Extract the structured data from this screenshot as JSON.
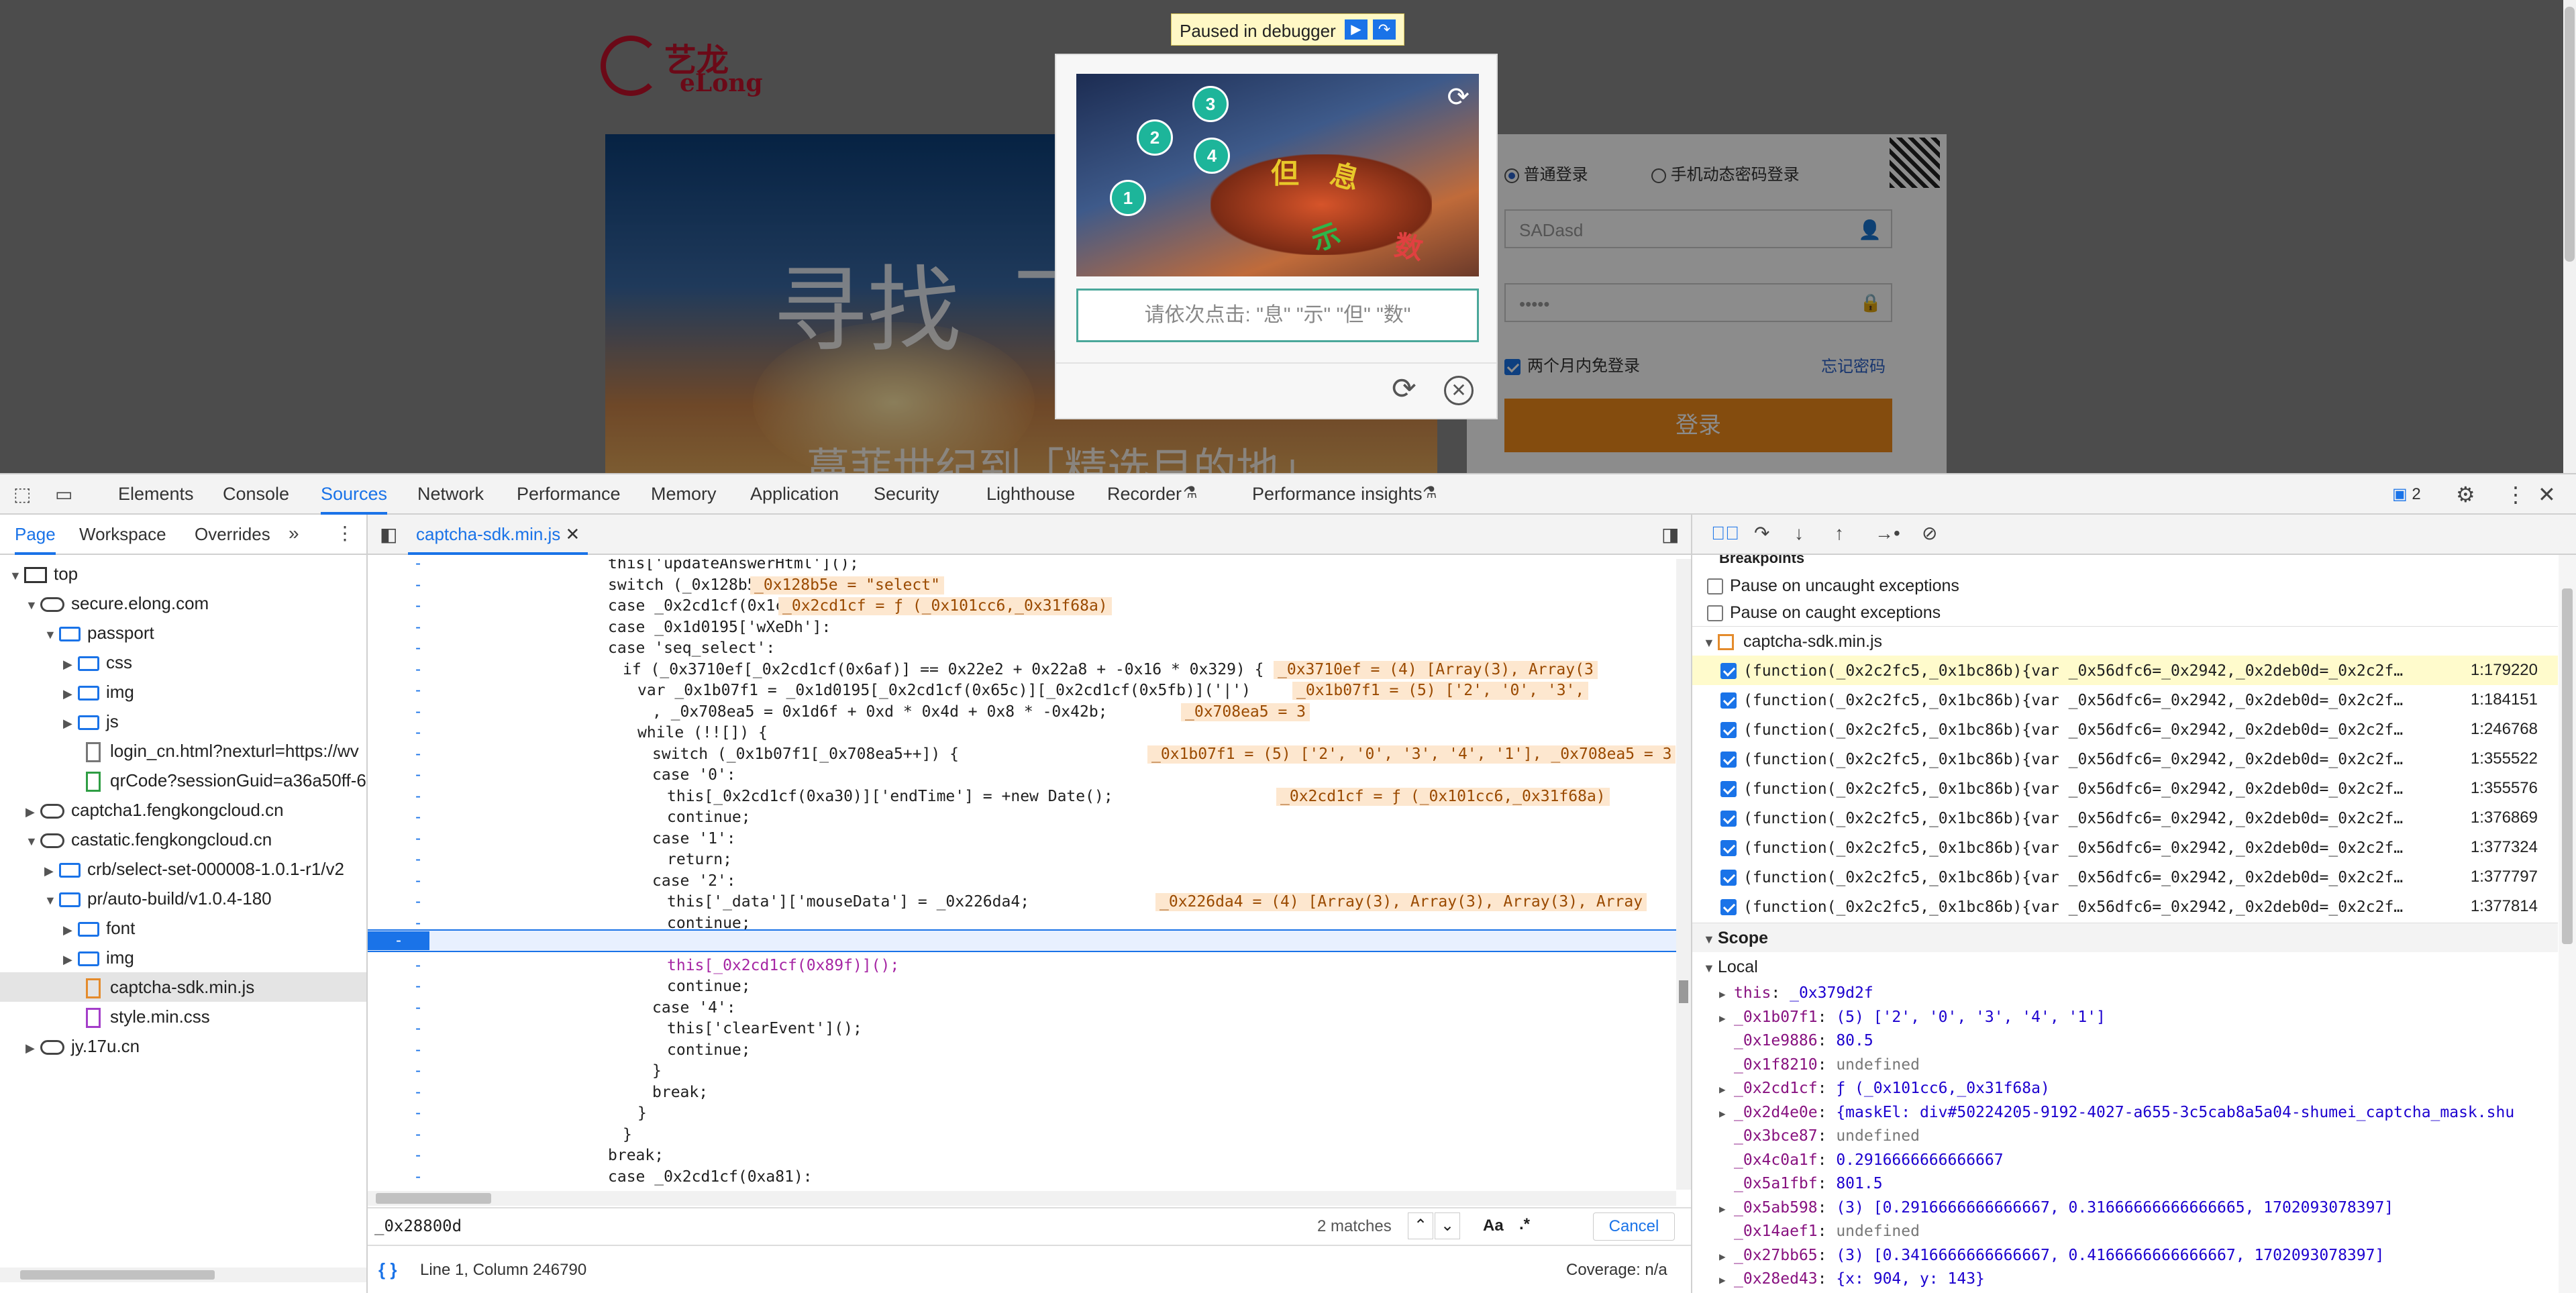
{
  "page": {
    "logo_cn": "艺龙",
    "logo_en": "eLong",
    "hero_text": "寻找  下",
    "hero_sub": "蔓菲世纪到「精选目的地」",
    "login": {
      "radio_normal": "普通登录",
      "radio_mobile": "手机动态密码登录",
      "username": "SADasd",
      "password": "•••••",
      "remember": "两个月内免登录",
      "forgot": "忘记密码",
      "submit": "登录"
    }
  },
  "debugger_badge": {
    "label": "Paused in debugger"
  },
  "captcha": {
    "dots": [
      "1",
      "2",
      "3",
      "4"
    ],
    "chars": [
      "息",
      "示",
      "但",
      "数"
    ],
    "prompt": "请依次点击: \"息\" \"示\" \"但\" \"数\""
  },
  "devtools": {
    "tabs": [
      "Elements",
      "Console",
      "Sources",
      "Network",
      "Performance",
      "Memory",
      "Application",
      "Security",
      "Lighthouse",
      "Recorder",
      "Performance insights"
    ],
    "active_tab": "Sources",
    "issues_count": "2",
    "nav": {
      "tabs": [
        "Page",
        "Workspace",
        "Overrides"
      ],
      "tree": [
        {
          "label": "top"
        },
        {
          "label": "secure.elong.com"
        },
        {
          "label": "passport"
        },
        {
          "label": "css"
        },
        {
          "label": "img"
        },
        {
          "label": "js"
        },
        {
          "label": "login_cn.html?nexturl=https://wv"
        },
        {
          "label": "qrCode?sessionGuid=a36a50ff-6"
        },
        {
          "label": "captcha1.fengkongcloud.cn"
        },
        {
          "label": "castatic.fengkongcloud.cn"
        },
        {
          "label": "crb/select-set-000008-1.0.1-r1/v2"
        },
        {
          "label": "pr/auto-build/v1.0.4-180"
        },
        {
          "label": "font"
        },
        {
          "label": "img"
        },
        {
          "label": "captcha-sdk.min.js"
        },
        {
          "label": "style.min.css"
        },
        {
          "label": "jy.17u.cn"
        }
      ]
    },
    "editor": {
      "file_tab": "captcha-sdk.min.js",
      "lines": [
        "this['updateAnswerHtml']();",
        "switch (_0x128b5e) {",
        "case _0x2cd1cf(0x1ca):",
        "case _0x1d0195['wXeDh']:",
        "case 'seq_select':",
        "if (_0x3710ef[_0x2cd1cf(0x6af)] == 0x22e2 + 0x22a8 + -0x16 * 0x329) {",
        "var _0x1b07f1 = _0x1d0195[_0x2cd1cf(0x65c)][_0x2cd1cf(0x5fb)]('|')",
        ", _0x708ea5 = 0x1d6f + 0xd * 0x4d + 0x8 * -0x42b;",
        "while (!![]) {",
        "switch (_0x1b07f1[_0x708ea5++]) {",
        "case '0':",
        "this[_0x2cd1cf(0xa30)]['endTime'] = +new Date();",
        "continue;",
        "case '1':",
        "return;",
        "case '2':",
        "this['_data']['mouseData'] = _0x226da4;",
        "continue;",
        "case '3':",
        "this[_0x2cd1cf(0x89f)]();",
        "continue;",
        "case '4':",
        "this['clearEvent']();",
        "continue;",
        "}",
        "break;",
        "}",
        "}",
        "break;",
        "case _0x2cd1cf(0xa81):"
      ],
      "hints": {
        "h1": "_0x128b5e = \"select\"",
        "h2": "_0x2cd1cf = ƒ (_0x101cc6,_0x31f68a)",
        "h5": "_0x3710ef = (4) [Array(3), Array(3",
        "h6": "_0x1b07f1 = (5) ['2', '0', '3',",
        "h7": "_0x708ea5 = 3",
        "h9": "_0x1b07f1 = (5) ['2', '0', '3', '4', '1'], _0x708ea5 = 3",
        "h11": "_0x2cd1cf = ƒ (_0x101cc6,_0x31f68a)",
        "h16": "_0x226da4 = (4) [Array(3), Array(3), Array(3), Array"
      },
      "breakpoint_gutter": "-",
      "search_query": "_0x28800d",
      "search_matches": "2 matches",
      "search_case": "Aa",
      "search_regex": ".*",
      "search_cancel": "Cancel",
      "status_position": "Line 1, Column 246790",
      "status_coverage": "Coverage: n/a",
      "status_format": "{ }"
    },
    "debugger": {
      "breakpoints_heading": "Breakpoints",
      "pause_uncaught": "Pause on uncaught exceptions",
      "pause_caught": "Pause on caught exceptions",
      "bp_file": "captcha-sdk.min.js",
      "bp_code": "(function(_0x2c2fc5,_0x1bc86b){var _0x56dfc6=_0x2942,_0x2deb0d=_0x2c2f…",
      "bp_lines": [
        "1:179220",
        "1:184151",
        "1:246768",
        "1:355522",
        "1:355576",
        "1:376869",
        "1:377324",
        "1:377797",
        "1:377814"
      ],
      "scope_heading": "Scope",
      "local_heading": "Local",
      "scope": [
        {
          "name": "this",
          "value": "_0x379d2f",
          "expand": true
        },
        {
          "name": "_0x1b07f1",
          "value": "(5) ['2', '0', '3', '4', '1']",
          "expand": true
        },
        {
          "name": "_0x1e9886",
          "value": "80.5",
          "expand": false
        },
        {
          "name": "_0x1f8210",
          "value": "undefined",
          "expand": false
        },
        {
          "name": "_0x2cd1cf",
          "value": "ƒ (_0x101cc6,_0x31f68a)",
          "expand": true
        },
        {
          "name": "_0x2d4e0e",
          "value": "{maskEl: div#50224205-9192-4027-a655-3c5cab8a5a04-shumei_captcha_mask.shu",
          "expand": true
        },
        {
          "name": "_0x3bce87",
          "value": "undefined",
          "expand": false
        },
        {
          "name": "_0x4c0a1f",
          "value": "0.2916666666666667",
          "expand": false
        },
        {
          "name": "_0x5a1fbf",
          "value": "801.5",
          "expand": false
        },
        {
          "name": "_0x5ab598",
          "value": "(3) [0.2916666666666667, 0.31666666666666665, 1702093078397]",
          "expand": true
        },
        {
          "name": "_0x14aef1",
          "value": "undefined",
          "expand": false
        },
        {
          "name": "_0x27bb65",
          "value": "(3) [0.3416666666666667, 0.4166666666666667, 1702093078397]",
          "expand": true
        },
        {
          "name": "_0x28ed43",
          "value": "{x: 904, y: 143}",
          "expand": true
        }
      ]
    }
  }
}
